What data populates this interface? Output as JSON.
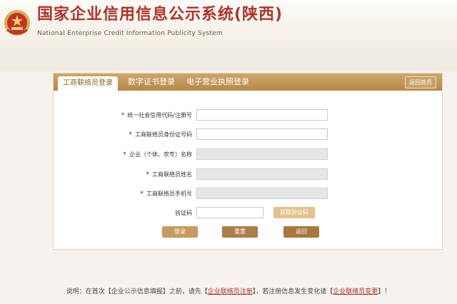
{
  "header": {
    "title": "国家企业信用信息公示系统(陕西)",
    "subtitle": "National Enterprise Credit Information Publicity System",
    "emblem_icon": "national-emblem-icon"
  },
  "tabs": [
    {
      "label": "工商联络员登录",
      "active": true
    },
    {
      "label": "数字证书登录",
      "active": false
    },
    {
      "label": "电子营业执照登录",
      "active": false
    }
  ],
  "back_home_label": "返回首页",
  "form": {
    "required_mark": "*",
    "fields": [
      {
        "label": "统一社会信用代码/注册号",
        "required": true,
        "value": "",
        "disabled": false
      },
      {
        "label": "工商联络员身份证号码",
        "required": true,
        "value": "",
        "disabled": false
      },
      {
        "label": "企业（个体、农专）名称",
        "required": true,
        "value": "",
        "disabled": true
      },
      {
        "label": "工商联络员姓名",
        "required": true,
        "value": "",
        "disabled": true
      },
      {
        "label": "工商联络员手机号",
        "required": true,
        "value": "",
        "disabled": true
      }
    ],
    "captcha_label": "验证码",
    "captcha_value": "",
    "get_code_label": "获取验证码"
  },
  "buttons": {
    "login": "登录",
    "reset": "重置",
    "back": "返回"
  },
  "note": {
    "prefix": "说明：在首次【企业公示信息填报】之前，请先【",
    "link1": "企业联络员注册",
    "middle": "】，若注册信息发生变化请【",
    "link2": "企业联络员变更",
    "suffix": "】！"
  },
  "colors": {
    "brand_red": "#b0322a",
    "tab_gold": "#c19558",
    "panel_border": "#e2d6c2"
  }
}
